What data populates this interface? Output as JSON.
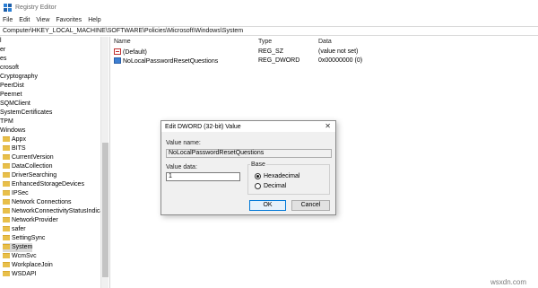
{
  "window": {
    "title": "Registry Editor",
    "app_icon": "registry-editor-icon"
  },
  "menu": [
    "File",
    "Edit",
    "View",
    "Favorites",
    "Help"
  ],
  "address": "Computer\\HKEY_LOCAL_MACHINE\\SOFTWARE\\Policies\\Microsoft\\Windows\\System",
  "tree": {
    "items": [
      {
        "label": "l",
        "folder": false
      },
      {
        "label": "er",
        "folder": false
      },
      {
        "label": "es",
        "folder": false
      },
      {
        "label": "crosoft",
        "folder": false
      },
      {
        "label": "Cryptography",
        "folder": false
      },
      {
        "label": "PeerDist",
        "folder": false
      },
      {
        "label": "Peernet",
        "folder": false
      },
      {
        "label": "SQMClient",
        "folder": false
      },
      {
        "label": "SystemCertificates",
        "folder": false
      },
      {
        "label": "TPM",
        "folder": false
      },
      {
        "label": "Windows",
        "folder": false
      },
      {
        "label": "Appx",
        "folder": true
      },
      {
        "label": "BITS",
        "folder": true
      },
      {
        "label": "CurrentVersion",
        "folder": true
      },
      {
        "label": "DataCollection",
        "folder": true
      },
      {
        "label": "DriverSearching",
        "folder": true
      },
      {
        "label": "EnhancedStorageDevices",
        "folder": true
      },
      {
        "label": "IPSec",
        "folder": true
      },
      {
        "label": "Network Connections",
        "folder": true
      },
      {
        "label": "NetworkConnectivityStatusIndicat",
        "folder": true
      },
      {
        "label": "NetworkProvider",
        "folder": true
      },
      {
        "label": "safer",
        "folder": true
      },
      {
        "label": "SettingSync",
        "folder": true
      },
      {
        "label": "System",
        "folder": true,
        "selected": true
      },
      {
        "label": "WcmSvc",
        "folder": true
      },
      {
        "label": "WorkplaceJoin",
        "folder": true
      },
      {
        "label": "WSDAPI",
        "folder": true
      }
    ]
  },
  "list": {
    "columns": [
      "Name",
      "Type",
      "Data"
    ],
    "rows": [
      {
        "name": "(Default)",
        "type": "REG_SZ",
        "data": "(value not set)",
        "icon": "string-value-icon"
      },
      {
        "name": "NoLocalPasswordResetQuestions",
        "type": "REG_DWORD",
        "data": "0x00000000 (0)",
        "icon": "dword-value-icon"
      }
    ]
  },
  "dialog": {
    "title": "Edit DWORD (32-bit) Value",
    "close": "✕",
    "value_name_label": "Value name:",
    "value_name": "NoLocalPasswordResetQuestions",
    "value_data_label": "Value data:",
    "value_data": "1",
    "base_label": "Base",
    "hex_label": "Hexadecimal",
    "dec_label": "Decimal",
    "base_selected": "Hexadecimal",
    "ok": "OK",
    "cancel": "Cancel"
  },
  "watermark": "wsxdn.com"
}
